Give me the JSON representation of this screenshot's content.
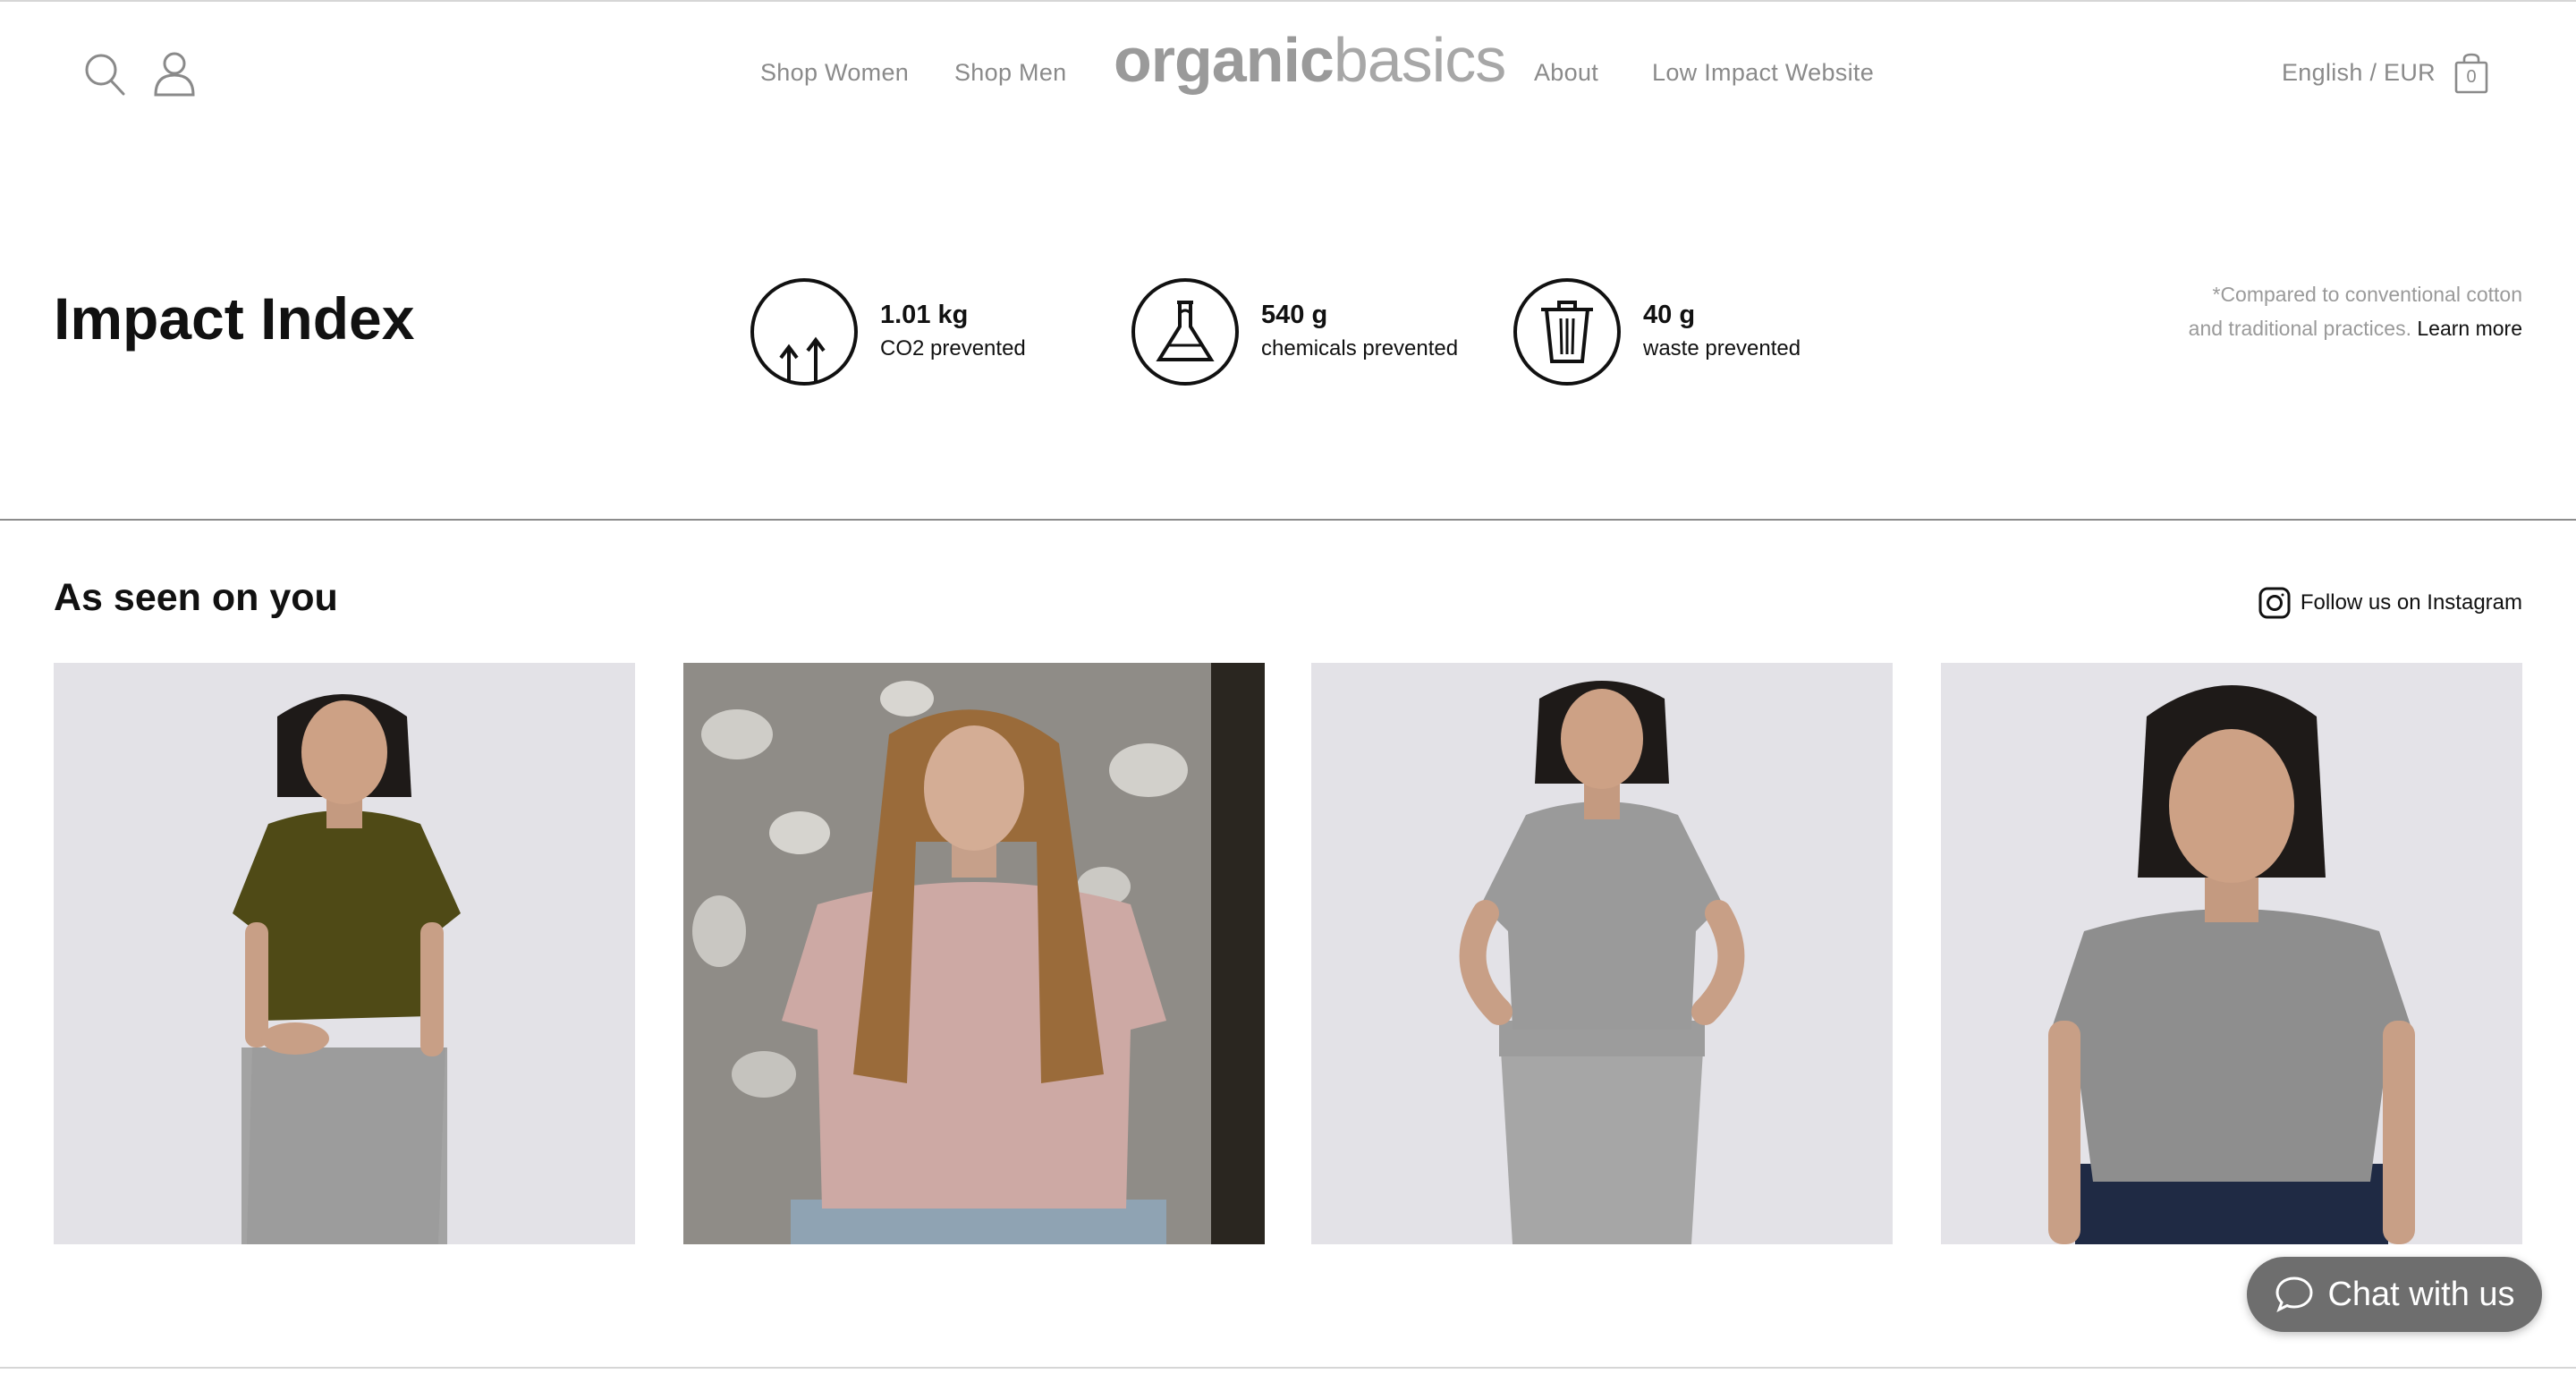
{
  "header": {
    "nav_left": [
      {
        "label": "Shop Women"
      },
      {
        "label": "Shop Men"
      }
    ],
    "logo": {
      "part1": "organic",
      "part2": "basics"
    },
    "nav_right": [
      {
        "label": "About"
      },
      {
        "label": "Low Impact Website"
      }
    ],
    "locale": "English / EUR",
    "cart_count": "0",
    "icons": {
      "search": "search-icon",
      "account": "user-icon",
      "cart": "shopping-bag-icon"
    }
  },
  "impact": {
    "title": "Impact Index",
    "items": [
      {
        "value": "1.01 kg",
        "label": "CO2 prevented",
        "icon": "co2-arrows-icon"
      },
      {
        "value": "540 g",
        "label": "chemicals prevented",
        "icon": "flask-icon"
      },
      {
        "value": "40 g",
        "label": "waste prevented",
        "icon": "trash-icon"
      }
    ],
    "note_line1": "*Compared to conventional cotton",
    "note_line2": "and traditional practices.",
    "learn_more": "Learn more"
  },
  "seen": {
    "title": "As seen on you",
    "instagram_label": "Follow us on Instagram",
    "instagram_icon": "instagram-icon",
    "photos": [
      {
        "name": "olive-tee-photo",
        "shirt_color": "#4f4a16"
      },
      {
        "name": "pink-tee-photo",
        "shirt_color": "#cda9a4"
      },
      {
        "name": "grey-tee-photo",
        "shirt_color": "#9a9a9a"
      },
      {
        "name": "grey-tee-jeans-photo",
        "shirt_color": "#8e8e8e"
      }
    ]
  },
  "chat": {
    "label": "Chat with us",
    "icon": "chat-bubble-icon"
  },
  "colors": {
    "nav_text": "#8a8a8a",
    "logo": "#a7a7a7",
    "chat_bg": "#6e6e6e",
    "text": "#111111"
  }
}
